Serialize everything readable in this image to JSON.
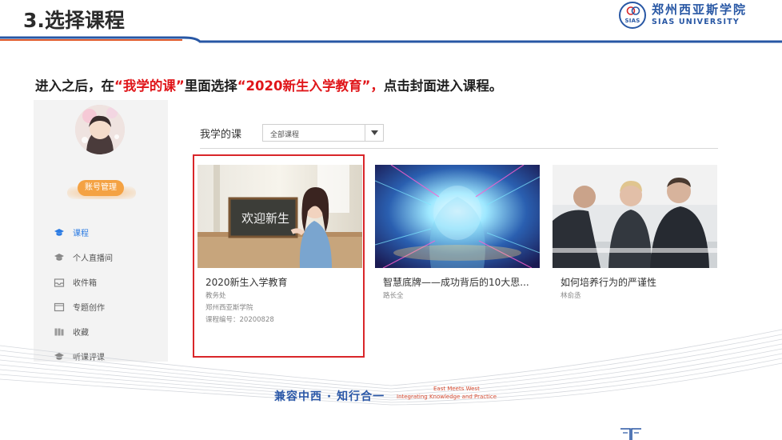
{
  "slide": {
    "title": "3.选择课程",
    "instruction": {
      "part1": "进入之后，在",
      "hl1": "“我学的课”",
      "part2": "里面选择",
      "hl2": "“2020新生入学教育”，",
      "part3": "点击封面进入课程。"
    }
  },
  "logo": {
    "cn": "郑州西亚斯学院",
    "en": "SIAS UNIVERSITY",
    "badge": "SIAS"
  },
  "sidebar": {
    "account_button": "账号管理",
    "items": [
      {
        "label": "课程",
        "icon": "graduation-cap-icon",
        "active": true
      },
      {
        "label": "个人直播间",
        "icon": "graduation-cap-icon",
        "active": false
      },
      {
        "label": "收件箱",
        "icon": "inbox-icon",
        "active": false
      },
      {
        "label": "专题创作",
        "icon": "window-icon",
        "active": false
      },
      {
        "label": "收藏",
        "icon": "books-icon",
        "active": false
      },
      {
        "label": "听课评课",
        "icon": "graduation-cap-icon",
        "active": false
      }
    ]
  },
  "main": {
    "tab_label": "我学的课",
    "filter_value": "全部课程",
    "courses": [
      {
        "title": "2020新生入学教育",
        "dept": "教务处",
        "school": "郑州西亚斯学院",
        "code": "课程编号：20200828",
        "cover_text": "欢迎新生"
      },
      {
        "title": "智慧底牌——成功背后的10大思...",
        "dept": "路长全"
      },
      {
        "title": "如何培养行为的严谨性",
        "dept": "林俞丞"
      }
    ]
  },
  "footer": {
    "motto": "兼容中西 · 知行合一",
    "motto_en_1": "East Meets West",
    "motto_en_2": "Integrating Knowledge and Practice"
  },
  "colors": {
    "accent_red": "#e0161a",
    "brand_blue": "#2857a4",
    "active_nav": "#2b7be3",
    "account_orange": "#f4a243"
  }
}
